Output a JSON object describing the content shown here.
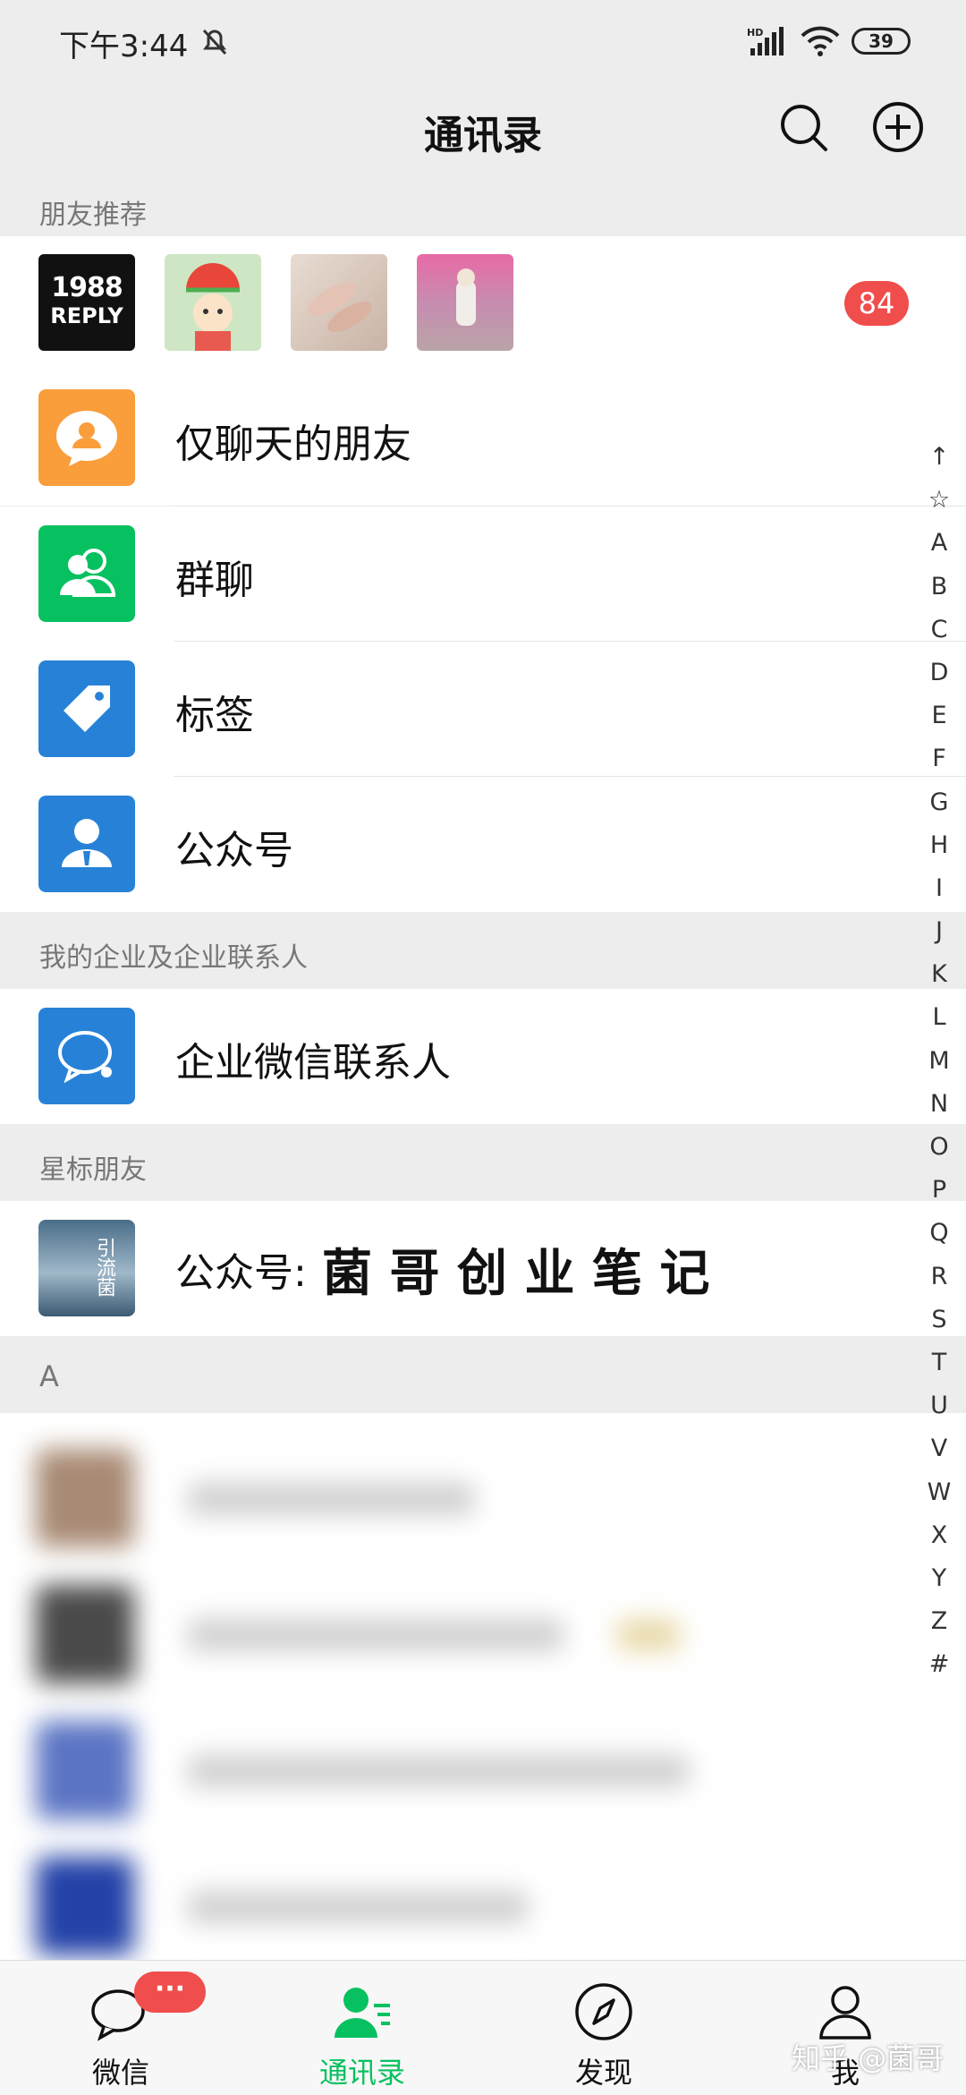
{
  "status_bar": {
    "time": "下午3:44",
    "battery": "39"
  },
  "header": {
    "title": "通讯录"
  },
  "recommend": {
    "section_title": "朋友推荐",
    "thumb1_text_a": "1988",
    "thumb1_text_b": "REPLY",
    "badge": "84"
  },
  "menu": [
    {
      "label": "仅聊天的朋友"
    },
    {
      "label": "群聊"
    },
    {
      "label": "标签"
    },
    {
      "label": "公众号"
    }
  ],
  "enterprise": {
    "section_title": "我的企业及企业联系人",
    "item_label": "企业微信联系人"
  },
  "starred": {
    "section_title": "星标朋友",
    "item_prefix": "公众号:",
    "item_name": "菌 哥 创 业 笔 记",
    "avatar_text": "引流菌"
  },
  "section_a": {
    "title": "A"
  },
  "index_letters": [
    "↑",
    "☆",
    "A",
    "B",
    "C",
    "D",
    "E",
    "F",
    "G",
    "H",
    "I",
    "J",
    "K",
    "L",
    "M",
    "N",
    "O",
    "P",
    "Q",
    "R",
    "S",
    "T",
    "U",
    "V",
    "W",
    "X",
    "Y",
    "Z",
    "#"
  ],
  "tabs": [
    {
      "label": "微信",
      "badge": "···"
    },
    {
      "label": "通讯录"
    },
    {
      "label": "发现"
    },
    {
      "label": "我"
    }
  ],
  "watermark": "知乎 @菌哥",
  "colors": {
    "accent": "#07c160",
    "badge": "#f04d4d",
    "orange": "#fa9d3b",
    "blue": "#2782d7"
  }
}
